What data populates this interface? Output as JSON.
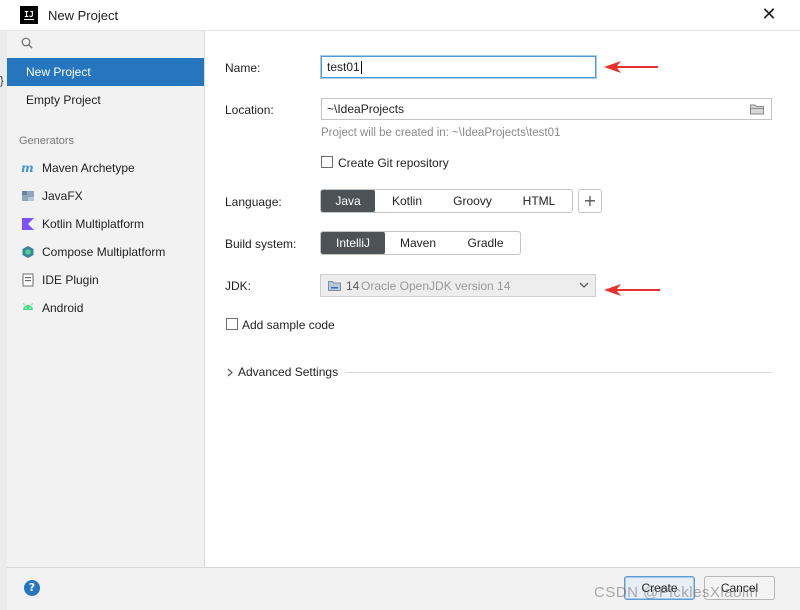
{
  "window": {
    "title": "New Project",
    "logo_text": "IJ",
    "close_glyph": "✕"
  },
  "sidebar": {
    "search_icon": "search-icon",
    "project_types": [
      {
        "label": "New Project",
        "selected": true
      },
      {
        "label": "Empty Project",
        "selected": false
      }
    ],
    "generators_header": "Generators",
    "generators": [
      {
        "label": "Maven Archetype",
        "icon": "maven-icon"
      },
      {
        "label": "JavaFX",
        "icon": "javafx-icon"
      },
      {
        "label": "Kotlin Multiplatform",
        "icon": "kotlin-icon"
      },
      {
        "label": "Compose Multiplatform",
        "icon": "compose-icon"
      },
      {
        "label": "IDE Plugin",
        "icon": "plugin-icon"
      },
      {
        "label": "Android",
        "icon": "android-icon"
      }
    ]
  },
  "form": {
    "name_label": "Name:",
    "name_value": "test01",
    "location_label": "Location:",
    "location_value": "~\\IdeaProjects",
    "location_hint": "Project will be created in: ~\\IdeaProjects\\test01",
    "git_checkbox_label": "Create Git repository",
    "git_checked": false,
    "language_label": "Language:",
    "languages": [
      "Java",
      "Kotlin",
      "Groovy",
      "HTML"
    ],
    "language_selected": "Java",
    "add_language_glyph": "+",
    "build_label": "Build system:",
    "build_systems": [
      "IntelliJ",
      "Maven",
      "Gradle"
    ],
    "build_selected": "IntelliJ",
    "jdk_label": "JDK:",
    "jdk_version": "14",
    "jdk_name": "Oracle OpenJDK version 14",
    "sample_code_label": "Add sample code",
    "sample_code_checked": false,
    "advanced_label": "Advanced Settings"
  },
  "footer": {
    "help_glyph": "?",
    "create_label": "Create",
    "cancel_label": "Cancel",
    "watermark": "CSDN @PicklesXiaolin"
  },
  "colors": {
    "selection_blue": "#2675bf",
    "segment_active": "#4d5256",
    "annotation_arrow": "#e8312c",
    "focus_border": "#4f9ad8"
  },
  "left_edge_glyph": "}"
}
